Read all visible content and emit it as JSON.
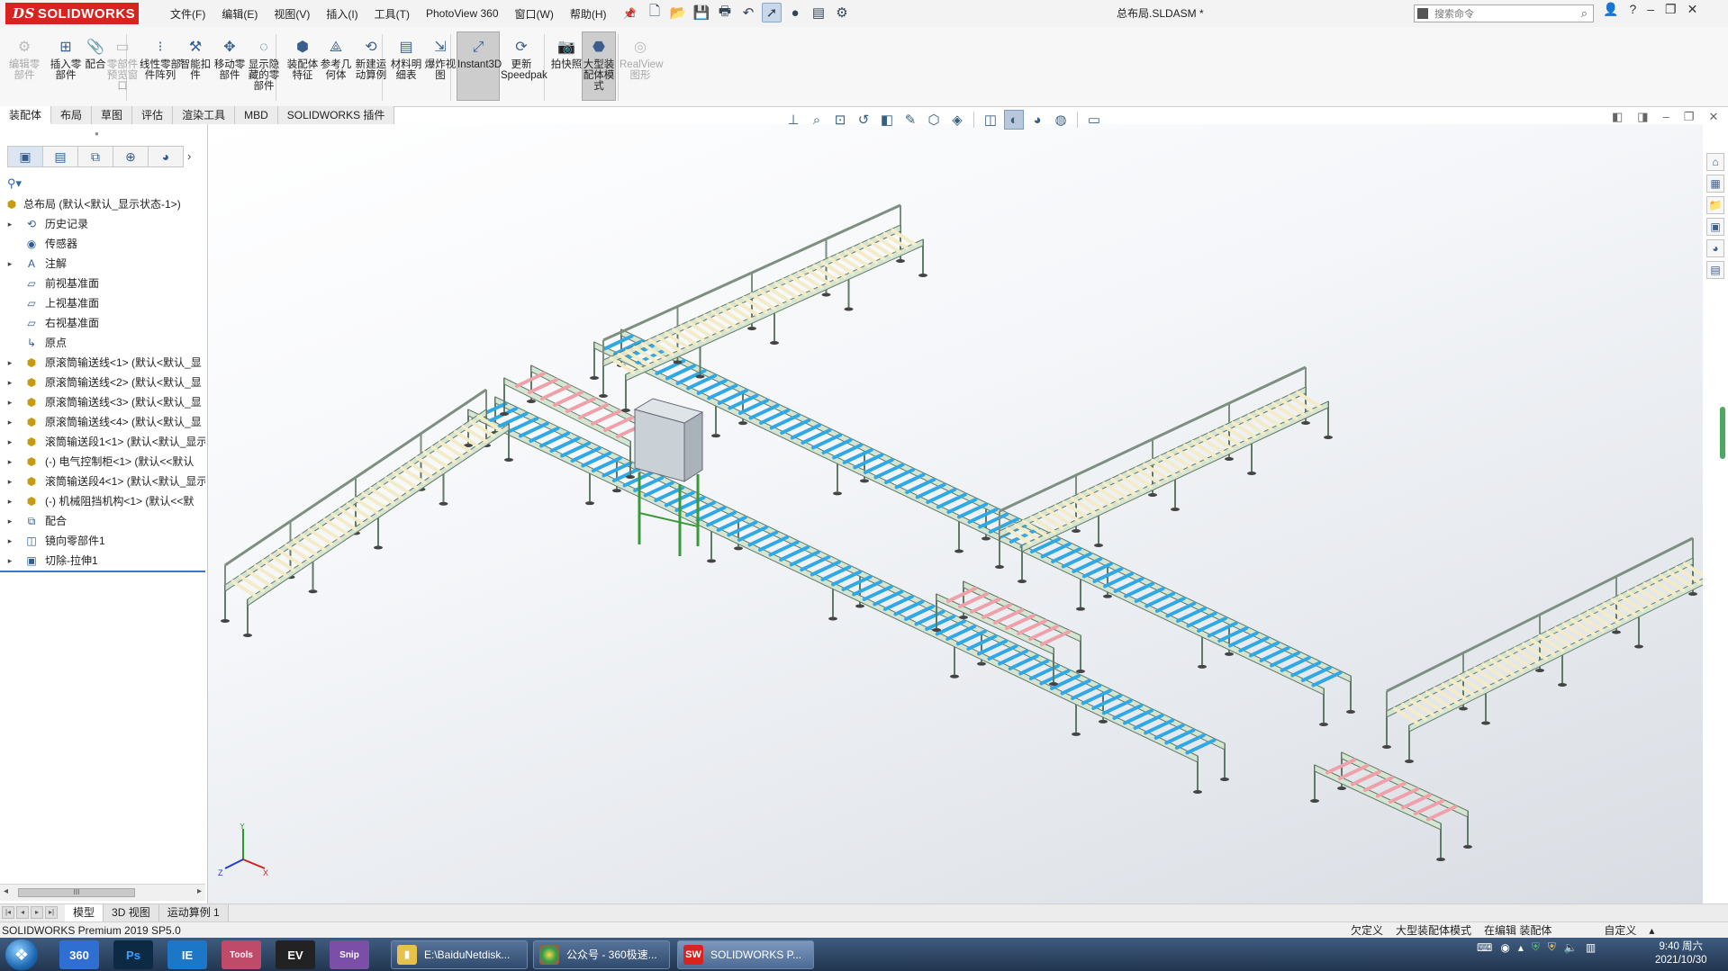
{
  "app": {
    "logo_text": "SOLIDWORKS",
    "document_title": "总布局.SLDASM *",
    "menus": [
      "文件(F)",
      "编辑(E)",
      "视图(V)",
      "插入(I)",
      "工具(T)",
      "PhotoView 360",
      "窗口(W)",
      "帮助(H)"
    ],
    "search_placeholder": "搜索命令"
  },
  "ribbon": {
    "buttons": [
      {
        "label": "编辑零\n部件",
        "icon": "edit-component-icon",
        "disabled": true
      },
      {
        "label": "插入零\n部件",
        "icon": "insert-component-icon",
        "disabled": false
      },
      {
        "label": "配合",
        "icon": "mate-icon",
        "disabled": false
      },
      {
        "label": "零部件\n预览窗\n口",
        "icon": "component-preview-icon",
        "disabled": true
      },
      {
        "label": "线性零部\n件阵列",
        "icon": "linear-pattern-icon",
        "disabled": false
      },
      {
        "label": "智能扣\n件",
        "icon": "smart-fastener-icon",
        "disabled": false
      },
      {
        "label": "移动零\n部件",
        "icon": "move-component-icon",
        "disabled": false
      },
      {
        "label": "显示隐\n藏的零\n部件",
        "icon": "show-hidden-icon",
        "disabled": false
      },
      {
        "label": "装配体\n特征",
        "icon": "assembly-feature-icon",
        "disabled": false
      },
      {
        "label": "参考几\n何体",
        "icon": "reference-geometry-icon",
        "disabled": false
      },
      {
        "label": "新建运\n动算例",
        "icon": "motion-study-icon",
        "disabled": false
      },
      {
        "label": "材料明\n细表",
        "icon": "bom-icon",
        "disabled": false
      },
      {
        "label": "爆炸视\n图",
        "icon": "exploded-view-icon",
        "disabled": false
      },
      {
        "label": "Instant3D",
        "icon": "instant3d-icon",
        "disabled": false,
        "active": true
      },
      {
        "label": "更新\nSpeedpak",
        "icon": "speedpak-icon",
        "disabled": false
      },
      {
        "label": "拍快照",
        "icon": "snapshot-icon",
        "disabled": false
      },
      {
        "label": "大型装\n配体模\n式",
        "icon": "large-assembly-icon",
        "disabled": false,
        "active": true
      },
      {
        "label": "RealView\n图形",
        "icon": "realview-icon",
        "disabled": true
      }
    ]
  },
  "command_tabs": [
    "装配体",
    "布局",
    "草图",
    "评估",
    "渲染工具",
    "MBD",
    "SOLIDWORKS 插件"
  ],
  "feature_tree": {
    "root": "总布局  (默认<默认_显示状态-1>)",
    "items": [
      {
        "label": "历史记录",
        "icon": "history-icon",
        "expandable": true
      },
      {
        "label": "传感器",
        "icon": "sensor-icon",
        "expandable": false
      },
      {
        "label": "注解",
        "icon": "annotation-icon",
        "expandable": true
      },
      {
        "label": "前视基准面",
        "icon": "plane-icon",
        "expandable": false
      },
      {
        "label": "上视基准面",
        "icon": "plane-icon",
        "expandable": false
      },
      {
        "label": "右视基准面",
        "icon": "plane-icon",
        "expandable": false
      },
      {
        "label": "原点",
        "icon": "origin-icon",
        "expandable": false
      },
      {
        "label": "原滚筒输送线<1> (默认<默认_显",
        "icon": "assembly-icon",
        "expandable": true
      },
      {
        "label": "原滚筒输送线<2> (默认<默认_显",
        "icon": "assembly-icon",
        "expandable": true
      },
      {
        "label": "原滚筒输送线<3> (默认<默认_显",
        "icon": "assembly-icon",
        "expandable": true
      },
      {
        "label": "原滚筒输送线<4> (默认<默认_显",
        "icon": "assembly-icon",
        "expandable": true
      },
      {
        "label": "滚筒输送段1<1> (默认<默认_显示",
        "icon": "assembly-icon",
        "expandable": true
      },
      {
        "label": "(-) 电气控制柜<1> (默认<<默认",
        "icon": "assembly-icon",
        "expandable": true
      },
      {
        "label": "滚筒输送段4<1> (默认<默认_显示",
        "icon": "assembly-icon",
        "expandable": true
      },
      {
        "label": "(-) 机械阻挡机构<1> (默认<<默",
        "icon": "assembly-icon",
        "expandable": true
      },
      {
        "label": "配合",
        "icon": "mates-folder-icon",
        "expandable": true
      },
      {
        "label": "镜向零部件1",
        "icon": "mirror-component-icon",
        "expandable": true
      },
      {
        "label": "切除-拉伸1",
        "icon": "cut-extrude-icon",
        "expandable": true
      }
    ]
  },
  "bottom_tabs": [
    "模型",
    "3D 视图",
    "运动算例 1"
  ],
  "status": {
    "left": "SOLIDWORKS Premium 2019 SP5.0",
    "right": [
      "欠定义",
      "大型装配体模式",
      "在编辑 装配体",
      "自定义"
    ]
  },
  "taskbar": {
    "pinned": [
      "360",
      "Ps",
      "IE",
      "Tools",
      "EV",
      "Snip"
    ],
    "windows": [
      {
        "label": "E:\\BaiduNetdisk...",
        "icon": "folder-icon"
      },
      {
        "label": "公众号 - 360极速...",
        "icon": "browser-icon"
      },
      {
        "label": "SOLIDWORKS P...",
        "icon": "solidworks-icon",
        "active": true
      }
    ],
    "clock_time": "9:40 周六",
    "clock_date": "2021/10/30"
  },
  "colors": {
    "brand": "#d8231f",
    "roller_blue": "#2fa8e6",
    "roller_pink": "#f0a0a8",
    "frame_green": "#7aa883",
    "roller_cream": "#f4ecc8"
  }
}
